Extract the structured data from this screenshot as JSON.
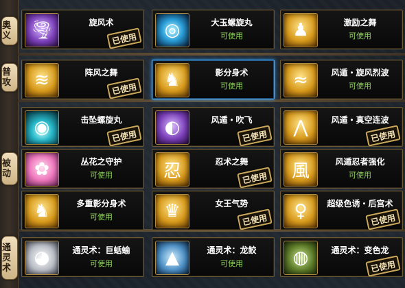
{
  "side_tabs": [
    {
      "id": "aoyi",
      "label": "奥义"
    },
    {
      "id": "pugong",
      "label": "普攻"
    },
    {
      "id": "beidong",
      "label": "被动"
    },
    {
      "id": "tonglingshu",
      "label": "通灵术"
    }
  ],
  "labels": {
    "used": "已使用",
    "available": "可使用"
  },
  "skills": [
    {
      "name": "旋风术",
      "status": "",
      "stamp": "已使用",
      "icon": "tornado-icon",
      "glyph": "🌪",
      "theme": "i-purple",
      "selected": false
    },
    {
      "name": "大玉螺旋丸",
      "status": "可使用",
      "stamp": "",
      "icon": "rasengan-icon",
      "glyph": "◎",
      "theme": "i-blue",
      "selected": false
    },
    {
      "name": "激励之舞",
      "status": "可使用",
      "stamp": "",
      "icon": "dancer-icon",
      "glyph": "♟",
      "theme": "i-gold",
      "selected": false
    },
    {
      "name": "阵风之舞",
      "status": "",
      "stamp": "已使用",
      "icon": "gust-dance-icon",
      "glyph": "≋",
      "theme": "i-gold",
      "selected": false
    },
    {
      "name": "影分身术",
      "status": "可使用",
      "stamp": "",
      "icon": "shadow-clone-icon",
      "glyph": "♞",
      "theme": "i-gold",
      "selected": true
    },
    {
      "name": "风遁・旋风烈波",
      "status": "可使用",
      "stamp": "",
      "icon": "wind-wave-icon",
      "glyph": "≈",
      "theme": "i-gold",
      "selected": false
    },
    {
      "name": "击坠螺旋丸",
      "status": "",
      "stamp": "已使用",
      "icon": "falling-rasengan-icon",
      "glyph": "◉",
      "theme": "i-cyan",
      "selected": false
    },
    {
      "name": "风遁・吹飞",
      "status": "",
      "stamp": "已使用",
      "icon": "fan-icon",
      "glyph": "◐",
      "theme": "i-purple",
      "selected": false
    },
    {
      "name": "风遁・真空连波",
      "status": "",
      "stamp": "已使用",
      "icon": "vacuum-wave-icon",
      "glyph": "⋀",
      "theme": "i-gold",
      "selected": false
    },
    {
      "name": "丛花之守护",
      "status": "可使用",
      "stamp": "",
      "icon": "flower-guard-icon",
      "glyph": "✿",
      "theme": "i-pink",
      "selected": false
    },
    {
      "name": "忍术之舞",
      "status": "",
      "stamp": "已使用",
      "icon": "ninja-scroll-icon",
      "glyph": "忍",
      "theme": "i-gold",
      "selected": false
    },
    {
      "name": "风遁忍者强化",
      "status": "可使用",
      "stamp": "",
      "icon": "wind-kanji-icon",
      "glyph": "風",
      "theme": "i-gold",
      "selected": false
    },
    {
      "name": "多重影分身术",
      "status": "可使用",
      "stamp": "",
      "icon": "multi-clone-icon",
      "glyph": "♞",
      "theme": "i-gold",
      "selected": false
    },
    {
      "name": "女王气势",
      "status": "",
      "stamp": "已使用",
      "icon": "queen-icon",
      "glyph": "♛",
      "theme": "i-gold",
      "selected": false
    },
    {
      "name": "超级色诱・后宫术",
      "status": "",
      "stamp": "已使用",
      "icon": "harem-icon",
      "glyph": "♀",
      "theme": "i-gold",
      "selected": false
    },
    {
      "name": "通灵术：巨蛞蝓",
      "status": "可使用",
      "stamp": "",
      "icon": "slug-icon",
      "glyph": "◕",
      "theme": "i-grey",
      "selected": false
    },
    {
      "name": "通灵术：龙鲛",
      "status": "可使用",
      "stamp": "",
      "icon": "shark-icon",
      "glyph": "▲",
      "theme": "i-shark",
      "selected": false
    },
    {
      "name": "通灵术：变色龙",
      "status": "",
      "stamp": "已使用",
      "icon": "chameleon-icon",
      "glyph": "◍",
      "theme": "i-green",
      "selected": false
    }
  ]
}
